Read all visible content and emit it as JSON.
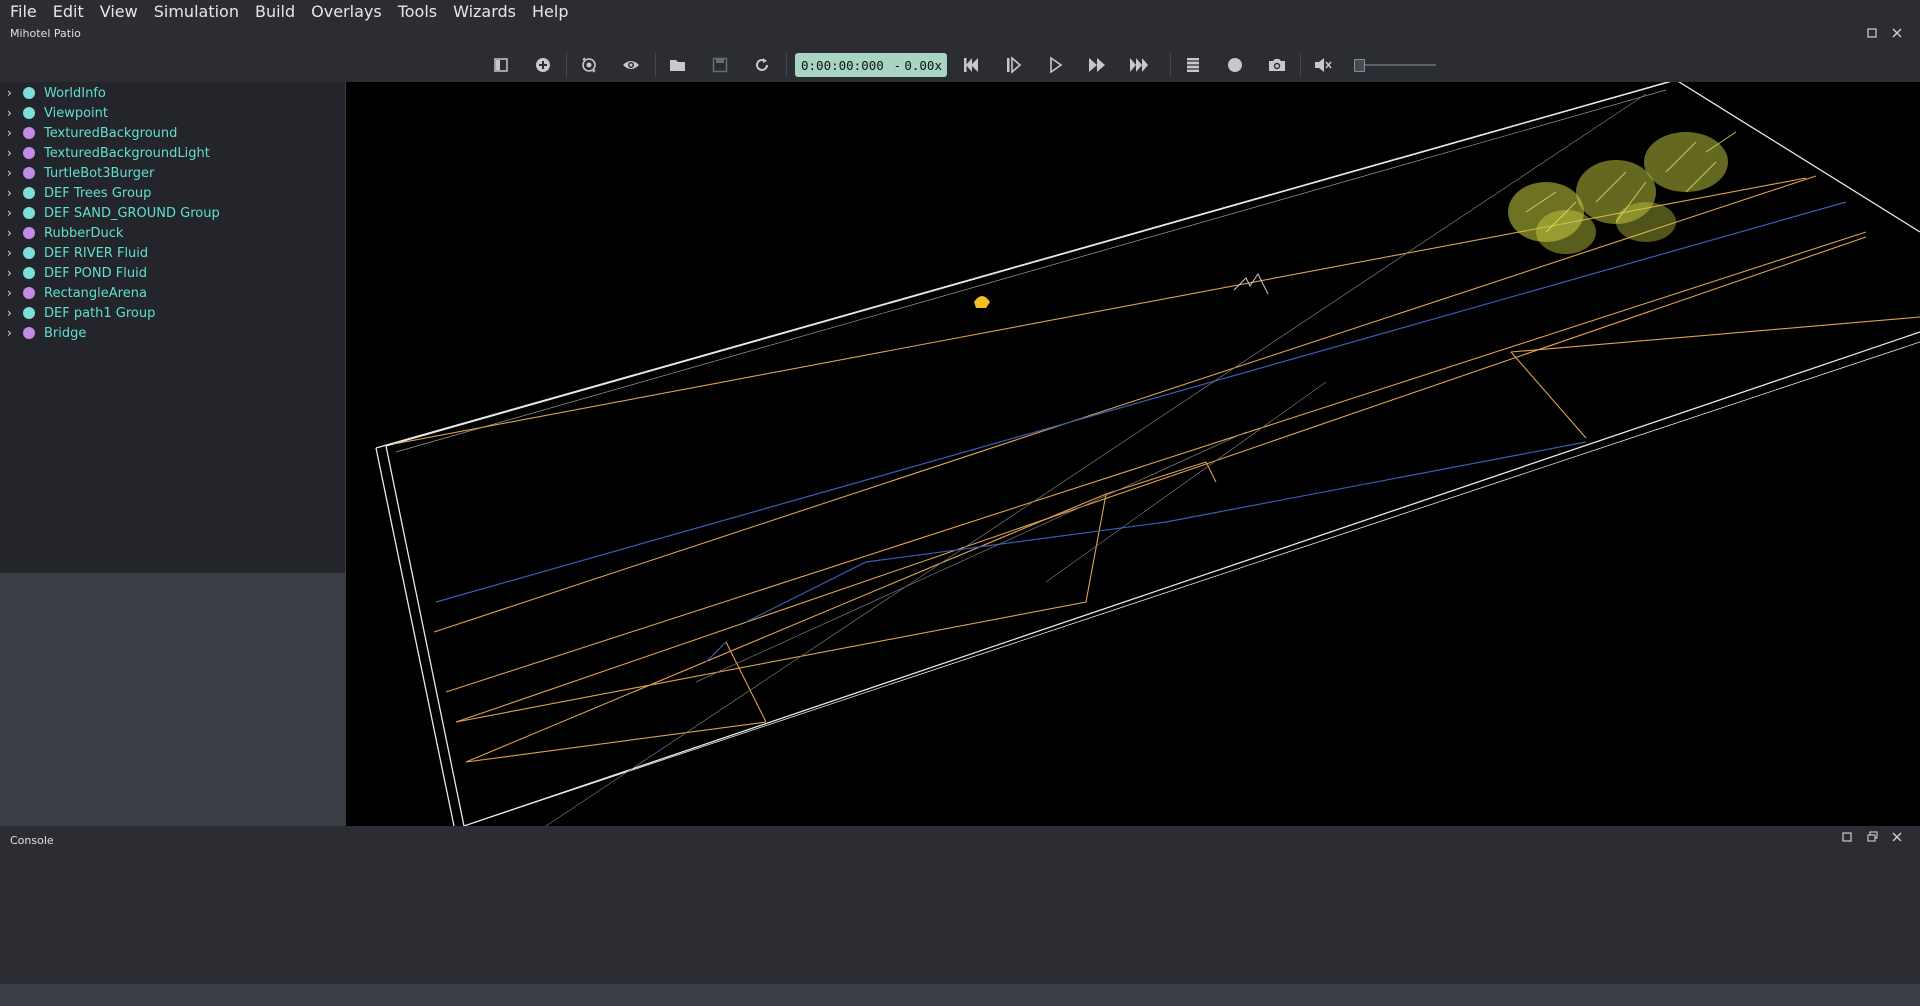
{
  "menu": [
    "File",
    "Edit",
    "View",
    "Simulation",
    "Build",
    "Overlays",
    "Tools",
    "Wizards",
    "Help"
  ],
  "window": {
    "title": "Mihotel Patio"
  },
  "toolbar": {
    "time": "0:00:00:000",
    "separator": "-",
    "speed": "0.00x",
    "volume_level": 0
  },
  "scene_tree": {
    "items": [
      {
        "label": "WorldInfo",
        "dot_color": "#7de0d8"
      },
      {
        "label": "Viewpoint",
        "dot_color": "#7de0d8"
      },
      {
        "label": "TexturedBackground",
        "dot_color": "#c38be8"
      },
      {
        "label": "TexturedBackgroundLight",
        "dot_color": "#c38be8"
      },
      {
        "label": "TurtleBot3Burger",
        "dot_color": "#c38be8"
      },
      {
        "label": "DEF Trees Group",
        "dot_color": "#7de0d8"
      },
      {
        "label": "DEF SAND_GROUND Group",
        "dot_color": "#7de0d8"
      },
      {
        "label": "RubberDuck",
        "dot_color": "#c38be8"
      },
      {
        "label": "DEF RIVER Fluid",
        "dot_color": "#7de0d8"
      },
      {
        "label": "DEF POND Fluid",
        "dot_color": "#7de0d8"
      },
      {
        "label": "RectangleArena",
        "dot_color": "#c38be8"
      },
      {
        "label": "DEF path1 Group",
        "dot_color": "#7de0d8"
      },
      {
        "label": "Bridge",
        "dot_color": "#c38be8"
      }
    ]
  },
  "console": {
    "title": "Console"
  },
  "colors": {
    "clock_bg": "#a8d5c3",
    "tree_text": "#5fe0cf",
    "wire_white": "#e8e8e8",
    "wire_orange": "#e0a050",
    "wire_blue": "#3a5db8",
    "trees": "#c8d040",
    "duck": "#f0c020"
  }
}
